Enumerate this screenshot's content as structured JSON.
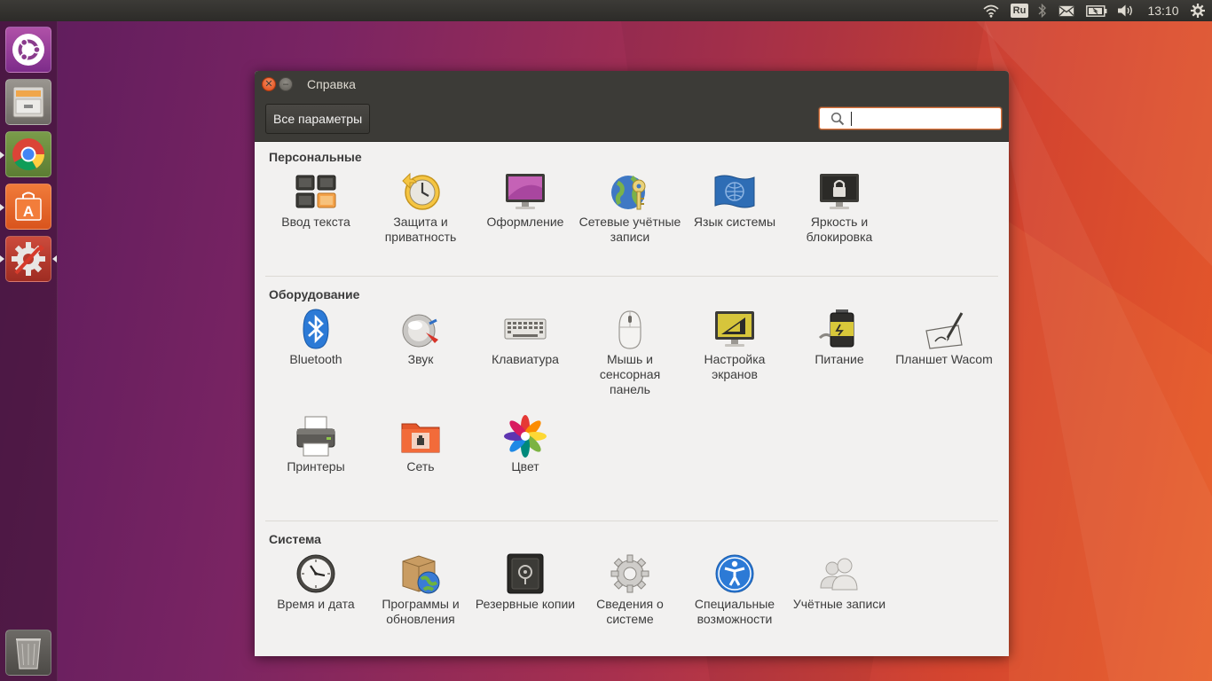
{
  "top_panel": {
    "keyboard_layout": "Ru",
    "clock": "13:10",
    "indicators": [
      "wifi-icon",
      "bluetooth-icon",
      "mail-icon",
      "battery-icon",
      "volume-icon",
      "gear-icon"
    ]
  },
  "launcher": {
    "items": [
      "ubuntu-dash-icon",
      "files-icon",
      "chrome-icon",
      "software-center-icon",
      "system-settings-icon",
      "trash-icon"
    ]
  },
  "window": {
    "title": "Справка",
    "all_settings_label": "Все параметры",
    "search_value": ""
  },
  "sections": {
    "personal": {
      "title": "Персональные",
      "items": [
        {
          "label": "Ввод текста",
          "icon": "text-entry-icon"
        },
        {
          "label": "Защита и приватность",
          "icon": "privacy-icon"
        },
        {
          "label": "Оформление",
          "icon": "appearance-icon"
        },
        {
          "label": "Сетевые учётные записи",
          "icon": "online-accounts-icon"
        },
        {
          "label": "Язык системы",
          "icon": "language-icon"
        },
        {
          "label": "Яркость и блокировка",
          "icon": "brightness-lock-icon"
        }
      ]
    },
    "hardware": {
      "title": "Оборудование",
      "items": [
        {
          "label": "Bluetooth",
          "icon": "bluetooth-icon"
        },
        {
          "label": "Звук",
          "icon": "sound-icon"
        },
        {
          "label": "Клавиатура",
          "icon": "keyboard-icon"
        },
        {
          "label": "Мышь и сенсорная панель",
          "icon": "mouse-icon"
        },
        {
          "label": "Настройка экранов",
          "icon": "displays-icon"
        },
        {
          "label": "Питание",
          "icon": "power-icon"
        },
        {
          "label": "Планшет Wacom",
          "icon": "wacom-tablet-icon"
        },
        {
          "label": "Принтеры",
          "icon": "printer-icon"
        },
        {
          "label": "Сеть",
          "icon": "network-icon"
        },
        {
          "label": "Цвет",
          "icon": "color-icon"
        }
      ]
    },
    "system": {
      "title": "Система",
      "items": [
        {
          "label": "Время и дата",
          "icon": "clock-icon"
        },
        {
          "label": "Программы и обновления",
          "icon": "software-updates-icon"
        },
        {
          "label": "Резервные копии",
          "icon": "backup-icon"
        },
        {
          "label": "Сведения о системе",
          "icon": "system-info-icon"
        },
        {
          "label": "Специальные возможности",
          "icon": "accessibility-icon"
        },
        {
          "label": "Учётные записи",
          "icon": "user-accounts-icon"
        }
      ]
    }
  },
  "colors": {
    "panel": "#3c3b37",
    "window_bg": "#f2f1f0",
    "accent_orange": "#e95420",
    "close_button": "#df4a16"
  }
}
